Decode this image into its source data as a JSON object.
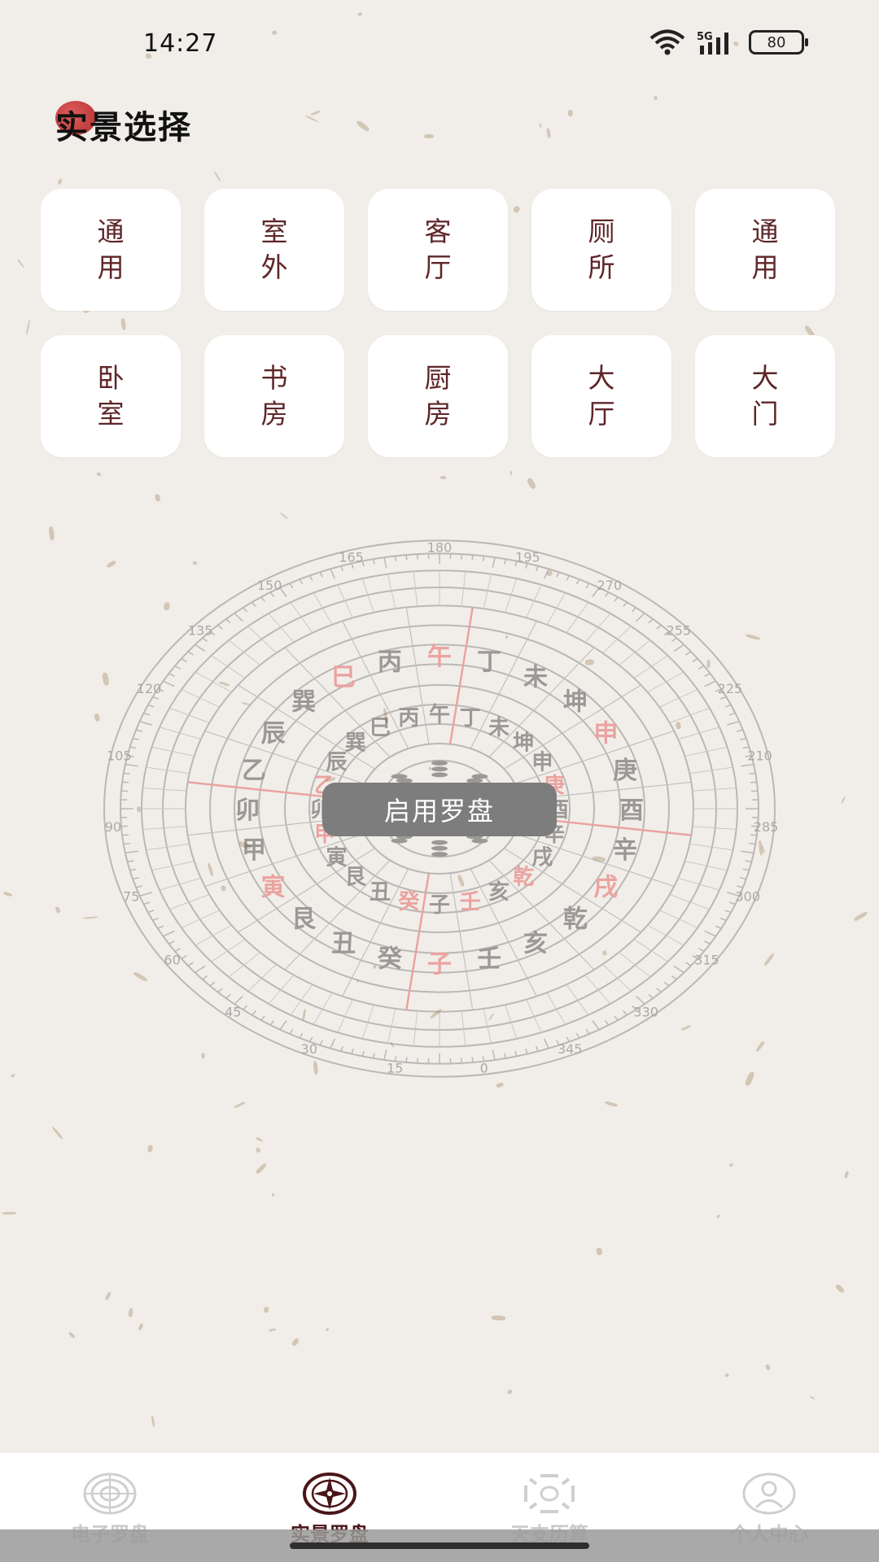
{
  "status": {
    "time": "14:27",
    "network": "5G",
    "battery": "80"
  },
  "title": "实景选择",
  "scenes": [
    "通用",
    "室外",
    "客厅",
    "厕所",
    "通用",
    "卧室",
    "书房",
    "厨房",
    "大厅",
    "大门"
  ],
  "compass": {
    "degrees": [
      "180",
      "195",
      "270",
      "255",
      "225",
      "210",
      "285",
      "300",
      "315",
      "330",
      "345",
      "0",
      "15",
      "30",
      "45",
      "60",
      "75",
      "90",
      "105",
      "120",
      "135",
      "150",
      "165"
    ],
    "ring_outer": [
      "午",
      "丁",
      "未",
      "坤",
      "申",
      "庚",
      "酉",
      "辛",
      "戌",
      "乾",
      "亥",
      "壬",
      "子",
      "癸",
      "丑",
      "艮",
      "寅",
      "甲",
      "卯",
      "乙",
      "辰",
      "巽",
      "巳",
      "丙"
    ],
    "ring_inner": [
      "午",
      "丁",
      "未",
      "坤",
      "申",
      "庚",
      "酉",
      "辛",
      "戌",
      "乾",
      "亥",
      "壬",
      "子",
      "癸",
      "丑",
      "艮",
      "寅",
      "甲",
      "卯",
      "乙",
      "辰",
      "巽",
      "巳",
      "丙"
    ],
    "red_marks": [
      "午",
      "申",
      "庚",
      "戌",
      "乾",
      "子",
      "癸",
      "壬",
      "寅",
      "甲",
      "乙",
      "巳"
    ]
  },
  "enable_button": "启用罗盘",
  "tabs": [
    {
      "label": "电子罗盘",
      "icon": "compass-wheel-icon",
      "active": false
    },
    {
      "label": "实景罗盘",
      "icon": "compass-star-icon",
      "active": true
    },
    {
      "label": "天支历算",
      "icon": "bagua-icon",
      "active": false
    },
    {
      "label": "个人中心",
      "icon": "user-icon",
      "active": false
    }
  ],
  "colors": {
    "accent": "#4a1518",
    "card_text": "#5e2628",
    "red": "#e24a4a",
    "background": "#f1eee9"
  }
}
